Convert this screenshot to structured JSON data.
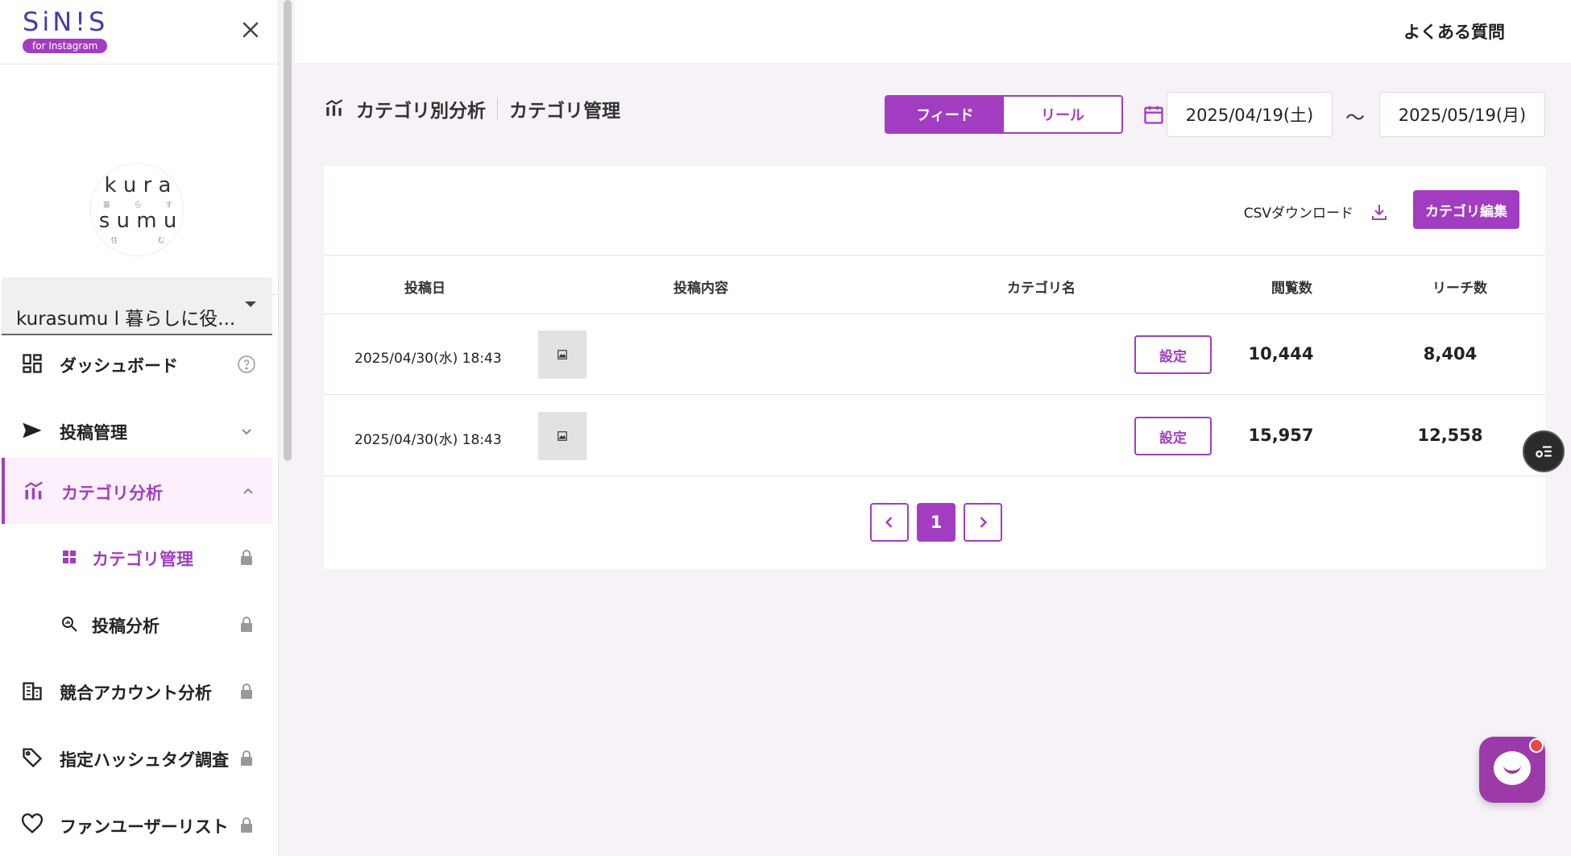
{
  "brand": {
    "logo": "SiN!S",
    "badge": "for Instagram"
  },
  "account": {
    "avatar_lines": [
      "k u r a",
      "s u m u"
    ],
    "avatar_small": [
      "暮",
      "ら",
      "す",
      "住",
      "む"
    ],
    "selected": "kurasumu l 暮らしに役..."
  },
  "nav": {
    "dashboard": "ダッシュボード",
    "posts": "投稿管理",
    "category_analysis": "カテゴリ分析",
    "category_manage": "カテゴリ管理",
    "post_analysis": "投稿分析",
    "competitor": "競合アカウント分析",
    "hashtag": "指定ハッシュタグ調査",
    "fans": "ファンユーザーリスト"
  },
  "topbar": {
    "faq": "よくある質問"
  },
  "header": {
    "crumb1": "カテゴリ別分析",
    "crumb2": "カテゴリ管理",
    "toggle_feed": "フィード",
    "toggle_reel": "リール",
    "date_from": "2025/04/19(土)",
    "date_sep": "〜",
    "date_to": "2025/05/19(月)"
  },
  "card": {
    "csv_label": "CSVダウンロード",
    "edit_label": "カテゴリ編集",
    "columns": [
      "投稿日",
      "投稿内容",
      "カテゴリ名",
      "閲覧数",
      "リーチ数"
    ],
    "rows": [
      {
        "date": "2025/04/30(水) 18:43",
        "action": "設定",
        "views": "10,444",
        "reach": "8,404"
      },
      {
        "date": "2025/04/30(水) 18:43",
        "action": "設定",
        "views": "15,957",
        "reach": "12,558"
      }
    ],
    "page": "1"
  },
  "colors": {
    "accent": "#a23dc1",
    "bg": "#f7f2f7"
  }
}
